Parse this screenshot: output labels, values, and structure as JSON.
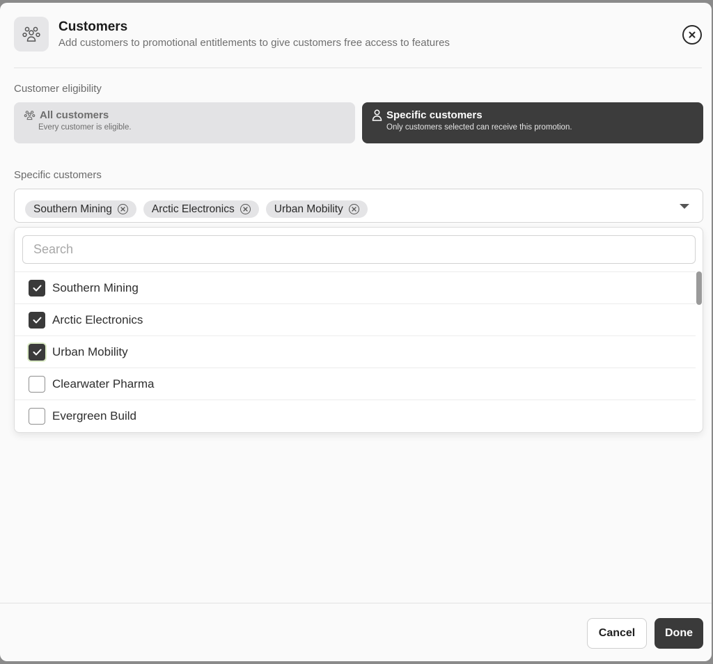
{
  "header": {
    "icon": "group-icon",
    "title": "Customers",
    "subtitle": "Add customers to promotional entitlements to give customers free access to features",
    "close_icon": "close-icon"
  },
  "eligibility": {
    "label": "Customer eligibility",
    "selected": "specific",
    "options": [
      {
        "id": "all",
        "icon": "group-icon",
        "title": "All customers",
        "description": "Every customer is eligible."
      },
      {
        "id": "specific",
        "icon": "user-icon",
        "title": "Specific customers",
        "description": "Only customers selected can receive this promotion."
      }
    ]
  },
  "specific": {
    "label": "Specific customers",
    "chips": [
      "Southern Mining",
      "Arctic Electronics",
      "Urban Mobility"
    ]
  },
  "dropdown": {
    "search_placeholder": "Search",
    "search_value": "",
    "options": [
      {
        "label": "Southern Mining",
        "checked": true
      },
      {
        "label": "Arctic Electronics",
        "checked": true
      },
      {
        "label": "Urban Mobility",
        "checked": true
      },
      {
        "label": "Clearwater Pharma",
        "checked": false
      },
      {
        "label": "Evergreen Build",
        "checked": false
      }
    ]
  },
  "footer": {
    "cancel_label": "Cancel",
    "done_label": "Done"
  },
  "colors": {
    "accent_dark": "#3a3a3a",
    "focus_ring": "#dcebc7"
  }
}
